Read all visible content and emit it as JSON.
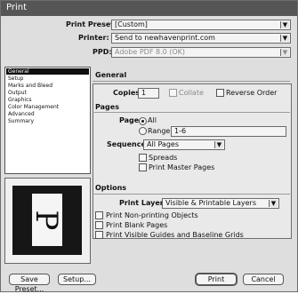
{
  "window": {
    "title": "Print"
  },
  "form": {
    "print_preset_label": "Print Preset:",
    "print_preset_value": "[Custom]",
    "printer_label": "Printer:",
    "printer_value": "Send to newhavenprint.com",
    "ppd_label": "PPD:",
    "ppd_value": "Adobe PDF 8.0 (OK)"
  },
  "sidebar": {
    "items": [
      {
        "label": "General",
        "selected": true
      },
      {
        "label": "Setup",
        "selected": false
      },
      {
        "label": "Marks and Bleed",
        "selected": false
      },
      {
        "label": "Output",
        "selected": false
      },
      {
        "label": "Graphics",
        "selected": false
      },
      {
        "label": "Color Management",
        "selected": false
      },
      {
        "label": "Advanced",
        "selected": false
      },
      {
        "label": "Summary",
        "selected": false
      }
    ]
  },
  "general": {
    "section_title": "General",
    "copies_label": "Copies:",
    "copies_value": "1",
    "collate_label": "Collate",
    "reverse_order_label": "Reverse Order"
  },
  "pages": {
    "section_title": "Pages",
    "pages_label": "Pages:",
    "all_label": "All",
    "range_label": "Range:",
    "range_value": "1-6",
    "sequence_label": "Sequence:",
    "sequence_value": "All Pages",
    "spreads_label": "Spreads",
    "print_master_pages_label": "Print Master Pages"
  },
  "options": {
    "section_title": "Options",
    "print_layers_label": "Print Layers:",
    "print_layers_value": "Visible & Printable Layers",
    "print_non_printing_label": "Print Non-printing Objects",
    "print_blank_pages_label": "Print Blank Pages",
    "print_visible_guides_label": "Print Visible Guides and Baseline Grids"
  },
  "preview": {
    "page_label": "P"
  },
  "buttons": {
    "save_preset": "Save Preset...",
    "setup": "Setup...",
    "print": "Print",
    "cancel": "Cancel"
  },
  "colors": {
    "titlebar": "#565656",
    "dialog_bg": "#dedede",
    "selected_item_bg": "#0f0f0f"
  },
  "icons": {
    "dropdown": "chevron-down-icon",
    "preview": "page-preview-icon"
  }
}
